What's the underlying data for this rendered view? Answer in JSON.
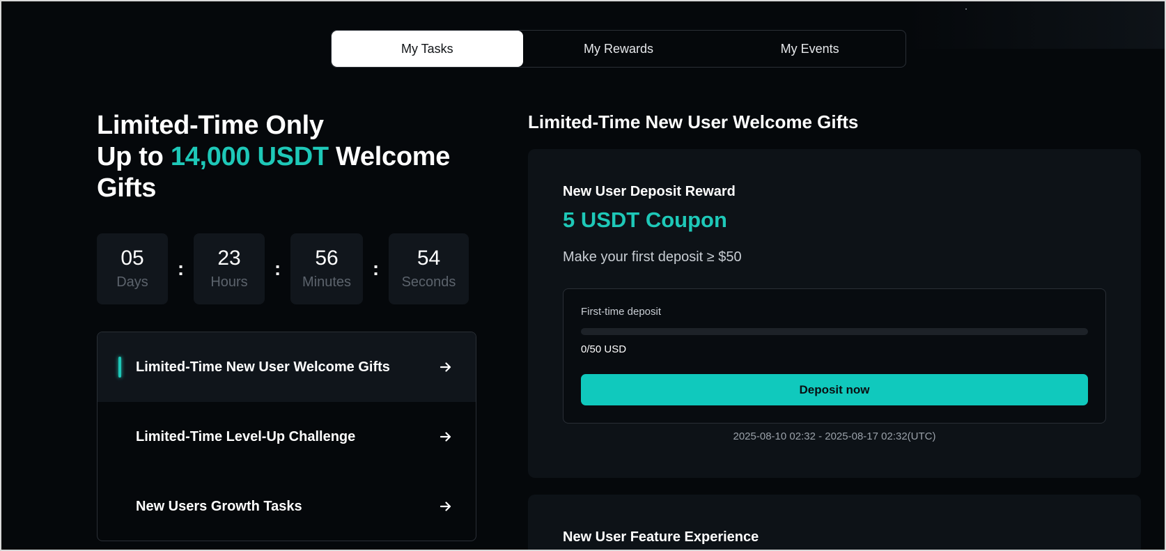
{
  "tabs": [
    {
      "label": "My Tasks",
      "active": true
    },
    {
      "label": "My Rewards",
      "active": false
    },
    {
      "label": "My Events",
      "active": false
    }
  ],
  "hero": {
    "line1": "Limited-Time Only",
    "line2_prefix": "Up to ",
    "line2_accent": "14,000 USDT",
    "line2_suffix": " Welcome Gifts"
  },
  "countdown": {
    "separator": ":",
    "units": [
      {
        "value": "05",
        "label": "Days"
      },
      {
        "value": "23",
        "label": "Hours"
      },
      {
        "value": "56",
        "label": "Minutes"
      },
      {
        "value": "54",
        "label": "Seconds"
      }
    ]
  },
  "menu": {
    "items": [
      {
        "label": "Limited-Time New User Welcome Gifts",
        "active": true
      },
      {
        "label": "Limited-Time Level-Up Challenge",
        "active": false
      },
      {
        "label": "New Users Growth Tasks",
        "active": false
      }
    ],
    "arrow_icon": "arrow-right-icon"
  },
  "section": {
    "title": "Limited-Time New User Welcome Gifts"
  },
  "deposit_card": {
    "title": "New User Deposit Reward",
    "reward": "5 USDT Coupon",
    "requirement": "Make your first deposit ≥ $50",
    "progress_label": "First-time deposit",
    "progress_fraction": 0,
    "progress_amount": "0/50 USD",
    "button_label": "Deposit now",
    "period": "2025-08-10 02:32 - 2025-08-17 02:32(UTC)"
  },
  "feature_card": {
    "title": "New User Feature Experience"
  },
  "colors": {
    "accent": "#1ec8b8",
    "button": "#10c9bd",
    "background": "#05080b",
    "card": "#0d1217"
  }
}
